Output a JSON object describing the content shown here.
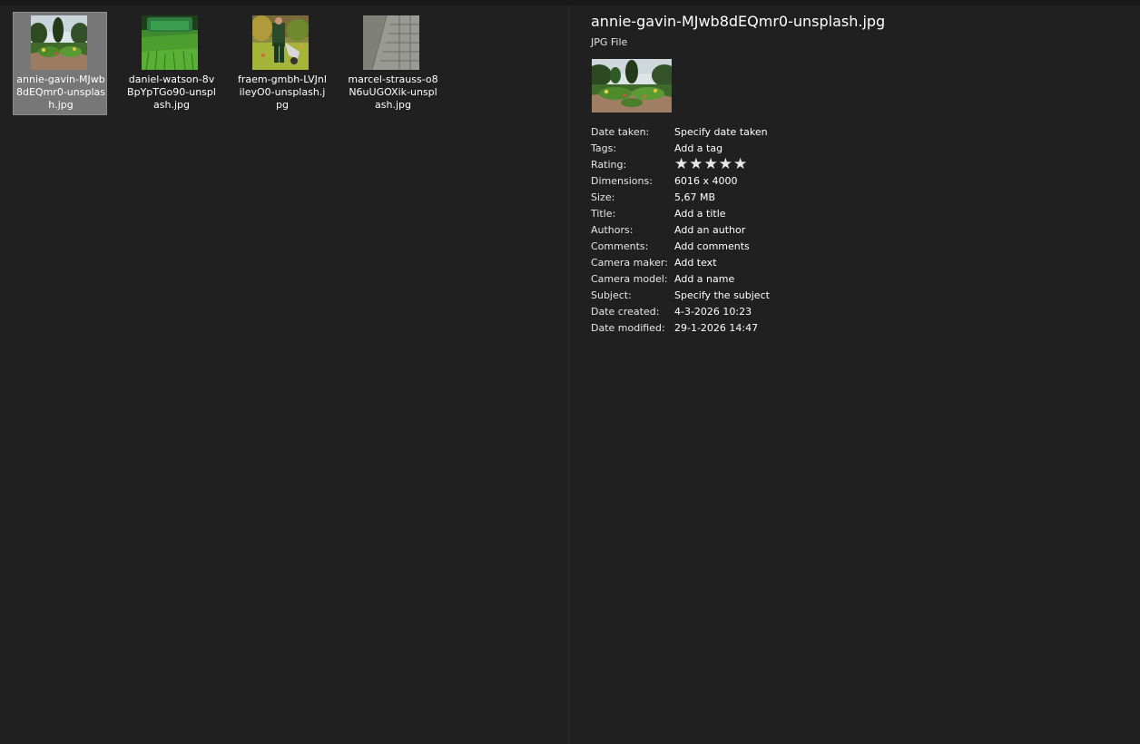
{
  "files": [
    {
      "name": "annie-gavin-MJwb8dEQmr0-unsplash.jpg",
      "display": "annie-gavin-MJwb8dEQmr0-unsplash.jpg",
      "selected": true
    },
    {
      "name": "daniel-watson-8vBpYpTGo90-unsplash.jpg",
      "display": "daniel-watson-8vBpYpTGo90-unsplash.jpg",
      "selected": false
    },
    {
      "name": "fraem-gmbh-LVJnlileyO0-unsplash.jpg",
      "display": "fraem-gmbh-LVJnlileyO0-unsplash.jpg",
      "selected": false
    },
    {
      "name": "marcel-strauss-o8N6uUGOXik-unsplash.jpg",
      "display": "marcel-strauss-o8N6uUGOXik-unsplash.jpg",
      "selected": false
    }
  ],
  "details": {
    "title": "annie-gavin-MJwb8dEQmr0-unsplash.jpg",
    "type": "JPG File",
    "properties": [
      {
        "label": "Date taken:",
        "value": "Specify date taken"
      },
      {
        "label": "Tags:",
        "value": "Add a tag"
      },
      {
        "label": "Rating:",
        "value": "",
        "stars": 5
      },
      {
        "label": "Dimensions:",
        "value": "6016 x 4000"
      },
      {
        "label": "Size:",
        "value": "5,67 MB"
      },
      {
        "label": "Title:",
        "value": "Add a title"
      },
      {
        "label": "Authors:",
        "value": "Add an author"
      },
      {
        "label": "Comments:",
        "value": "Add comments"
      },
      {
        "label": "Camera maker:",
        "value": "Add text"
      },
      {
        "label": "Camera model:",
        "value": "Add a name"
      },
      {
        "label": "Subject:",
        "value": "Specify the subject"
      },
      {
        "label": "Date created:",
        "value": "4-3-2026 10:23"
      },
      {
        "label": "Date modified:",
        "value": "29-1-2026 14:47"
      }
    ],
    "star_glyph": "★"
  },
  "colors": {
    "background": "#202020",
    "selection": "#777777",
    "text": "#ffffff"
  }
}
